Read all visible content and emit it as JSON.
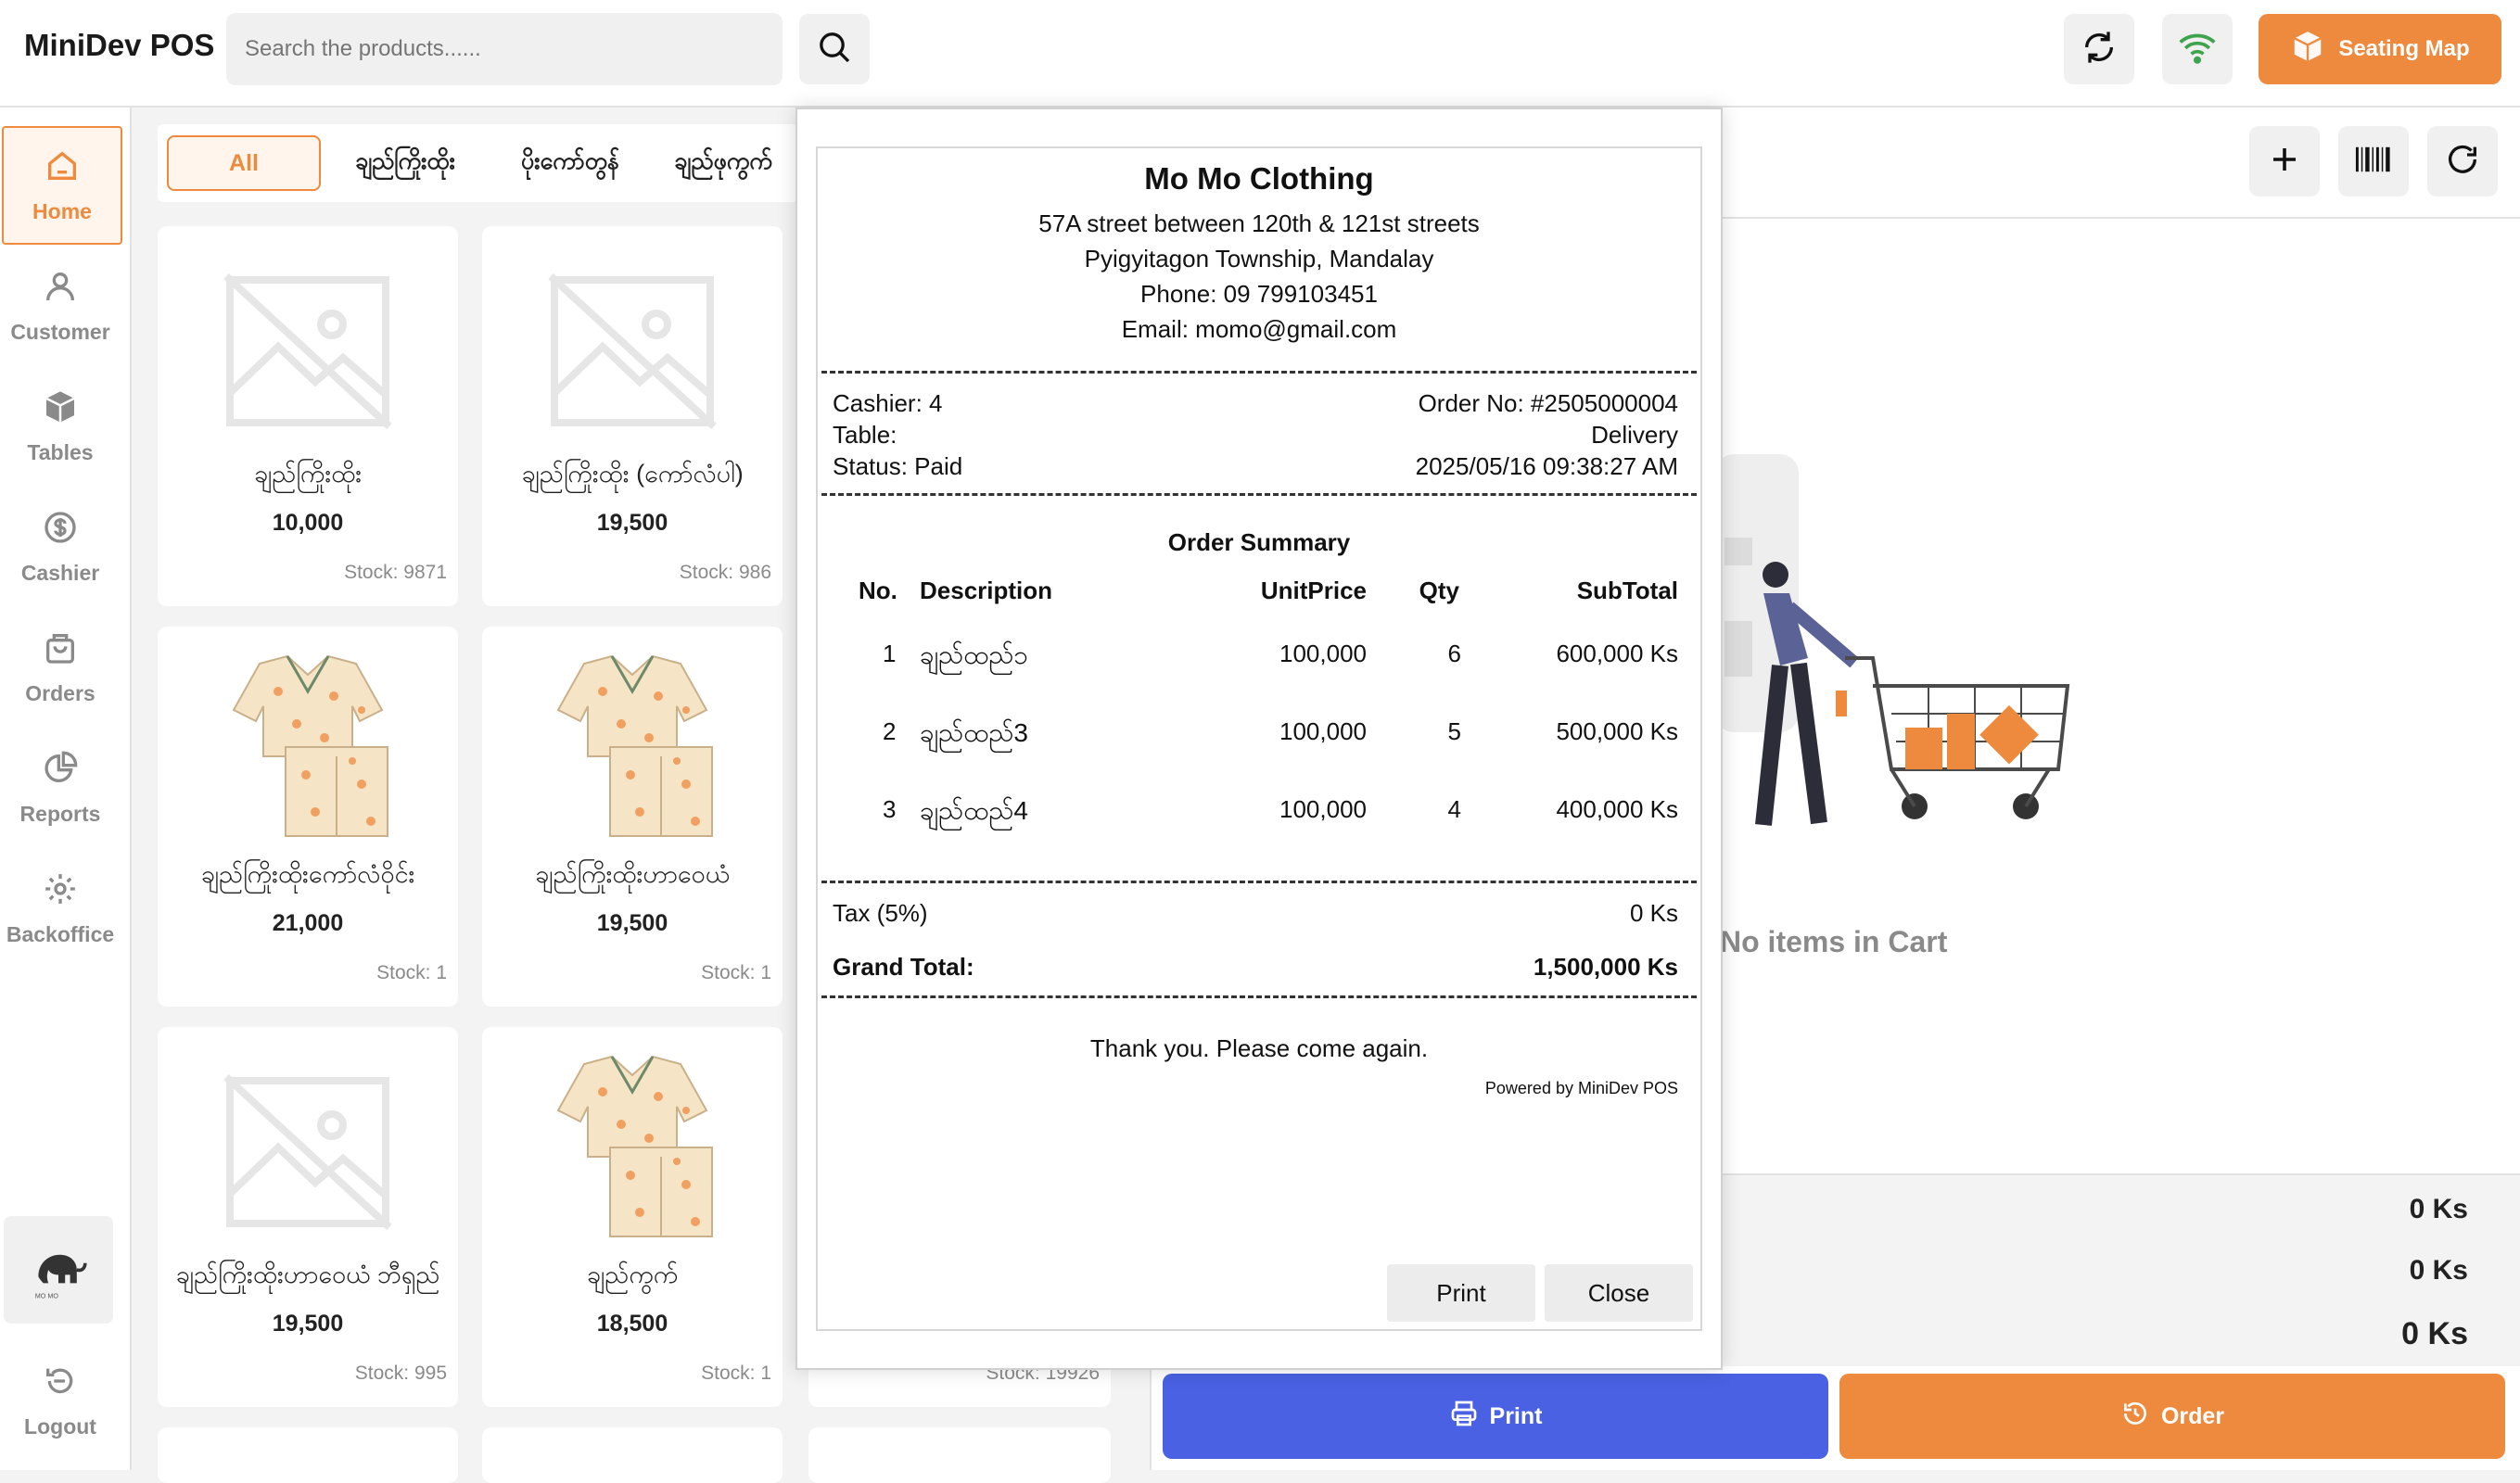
{
  "app": {
    "title": "MiniDev POS"
  },
  "search": {
    "placeholder": "Search the products......"
  },
  "header": {
    "seating_label": "Seating Map"
  },
  "sidebar": {
    "items": [
      {
        "label": "Home"
      },
      {
        "label": "Customer"
      },
      {
        "label": "Tables"
      },
      {
        "label": "Cashier"
      },
      {
        "label": "Orders"
      },
      {
        "label": "Reports"
      },
      {
        "label": "Backoffice"
      }
    ],
    "logout_label": "Logout"
  },
  "categories": [
    "All",
    "ချည်ကြိုးထိုး",
    "ပိုးကော်တွန်",
    "ချည်ဖုကွက်"
  ],
  "products": [
    {
      "name": "ချည်ကြိုးထိုး",
      "price": "10,000",
      "stock": "Stock: 9871",
      "image": "placeholder"
    },
    {
      "name": "ချည်ကြိုးထိုး (ကော်လံပါ)",
      "price": "19,500",
      "stock": "Stock: 986",
      "image": "placeholder"
    },
    {
      "name": "ချည်ကြိုးထိုးကော်လံဝိုင်း",
      "price": "21,000",
      "stock": "Stock: 1",
      "image": "pajama"
    },
    {
      "name": "ချည်ကြိုးထိုးဟာဝေယံ",
      "price": "19,500",
      "stock": "Stock: 1",
      "image": "pajama"
    },
    {
      "name": "ချည်ကြိုးထိုးဟာဝေယံ ဘီရှည်",
      "price": "19,500",
      "stock": "Stock: 995",
      "image": "placeholder"
    },
    {
      "name": "ချည်ကွက်",
      "price": "18,500",
      "stock": "Stock: 1",
      "image": "pajama"
    }
  ],
  "partial_stock": "Stock: 19926",
  "cart": {
    "empty_label": "No items in Cart",
    "totals": [
      "0 Ks",
      "0 Ks",
      "0 Ks"
    ],
    "print_label": "Print",
    "order_label": "Order"
  },
  "receipt": {
    "shop_name": "Mo Mo Clothing",
    "address_1": "57A street between 120th & 121st streets",
    "address_2": "Pyigyitagon Township, Mandalay",
    "phone": "Phone: 09 799103451",
    "email": "Email: momo@gmail.com",
    "cashier": "Cashier: 4",
    "order_no": "Order No: #2505000004",
    "table": "Table:",
    "order_type": "Delivery",
    "status": "Status: Paid",
    "datetime": "2025/05/16 09:38:27 AM",
    "summary_title": "Order Summary",
    "columns": {
      "no": "No.",
      "desc": "Description",
      "unit": "UnitPrice",
      "qty": "Qty",
      "sub": "SubTotal"
    },
    "rows": [
      {
        "no": "1",
        "desc": "ချည်ထည်၁",
        "unit": "100,000",
        "qty": "6",
        "sub": "600,000 Ks"
      },
      {
        "no": "2",
        "desc": "ချည်ထည်3",
        "unit": "100,000",
        "qty": "5",
        "sub": "500,000 Ks"
      },
      {
        "no": "3",
        "desc": "ချည်ထည်4",
        "unit": "100,000",
        "qty": "4",
        "sub": "400,000 Ks"
      }
    ],
    "tax_label": "Tax (5%)",
    "tax_value": "0 Ks",
    "grand_label": "Grand Total:",
    "grand_value": "1,500,000 Ks",
    "thanks": "Thank you. Please come again.",
    "powered": "Powered by MiniDev POS",
    "print_label": "Print",
    "close_label": "Close"
  },
  "colors": {
    "accent": "#ee8a3d",
    "primary": "#4961e2",
    "wifi": "#3fa34d"
  }
}
